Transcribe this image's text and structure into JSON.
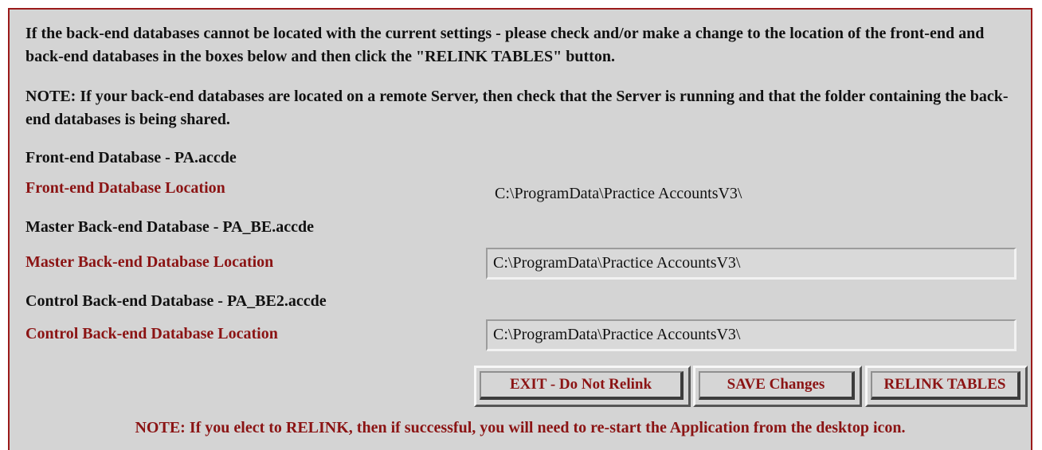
{
  "instructions": {
    "intro": "If the back-end databases cannot be located with the current settings - please check and/or make a change to the location of the front-end and back-end databases in the boxes below and then click the \"RELINK TABLES\" button.",
    "note_remote": "NOTE: If your back-end databases are located on a remote Server, then check that the Server is running and that the folder containing the back-end databases is being shared."
  },
  "front_end": {
    "db_label": "Front-end Database - PA.accde",
    "location_label": "Front-end Database Location",
    "location_value": "C:\\ProgramData\\Practice AccountsV3\\"
  },
  "master_back_end": {
    "db_label": "Master Back-end Database - PA_BE.accde",
    "location_label": "Master Back-end Database Location",
    "location_value": "C:\\ProgramData\\Practice AccountsV3\\"
  },
  "control_back_end": {
    "db_label": "Control Back-end Database - PA_BE2.accde",
    "location_label": "Control Back-end Database Location",
    "location_value": "C:\\ProgramData\\Practice AccountsV3\\"
  },
  "buttons": {
    "exit_label": "EXIT - Do Not Relink",
    "save_label": "SAVE Changes",
    "relink_label": "RELINK TABLES"
  },
  "footer": {
    "note_relink": "NOTE: If you elect to RELINK, then if successful, you will need to re-start the Application from the desktop icon."
  },
  "colors": {
    "panel_background": "#d4d4d4",
    "border_red": "#9b1a1a",
    "label_red": "#8b1414",
    "text_black": "#111111"
  }
}
